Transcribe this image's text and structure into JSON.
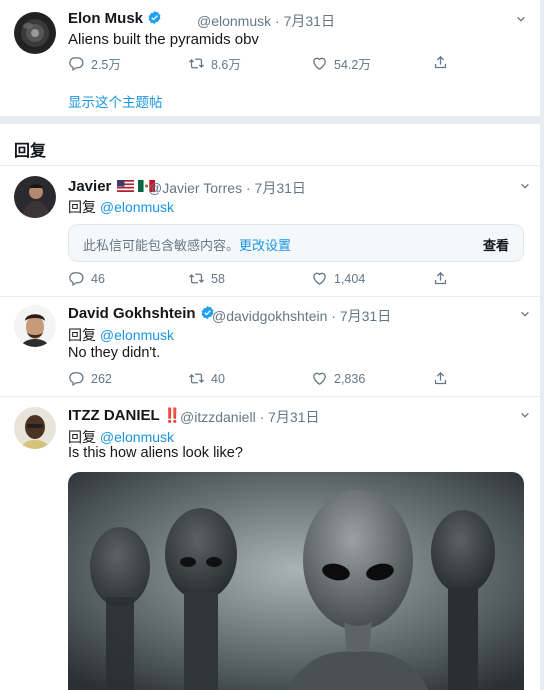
{
  "main_tweet": {
    "name": "Elon Musk",
    "handle": "@elonmusk",
    "date": "· 7月31日",
    "text": "Aliens built the pyramids obv",
    "replies": "2.5万",
    "retweets": "8.6万",
    "likes": "54.2万",
    "show_thread": "显示这个主题帖"
  },
  "replies_header": "回复",
  "replies": [
    {
      "name": "Javier",
      "handle_meta": "@Javier    Torres · 7月31日",
      "reply_prefix": "回复",
      "reply_to": "@elonmusk",
      "sensitive_msg": "此私信可能包含敏感内容。",
      "sensitive_link": "更改设置",
      "sensitive_view": "查看",
      "replies": "46",
      "retweets": "58",
      "likes": "1,404"
    },
    {
      "name": "David Gokhshtein",
      "handle_meta": "@davidgokhshtein · 7月31日",
      "reply_prefix": "回复",
      "reply_to": "@elonmusk",
      "text": "No they didn't.",
      "replies": "262",
      "retweets": "40",
      "likes": "2,836"
    },
    {
      "name": "ITZZ DANIEL",
      "badge": "‼️",
      "handle_meta": "@itzzdaniell · 7月31日",
      "reply_prefix": "回复",
      "reply_to": "@elonmusk",
      "text": "Is this how aliens look like?"
    }
  ],
  "colors": {
    "link": "#1b95e0",
    "muted": "#657786",
    "verified": "#1da1f2",
    "divider": "#e6ecf0"
  }
}
